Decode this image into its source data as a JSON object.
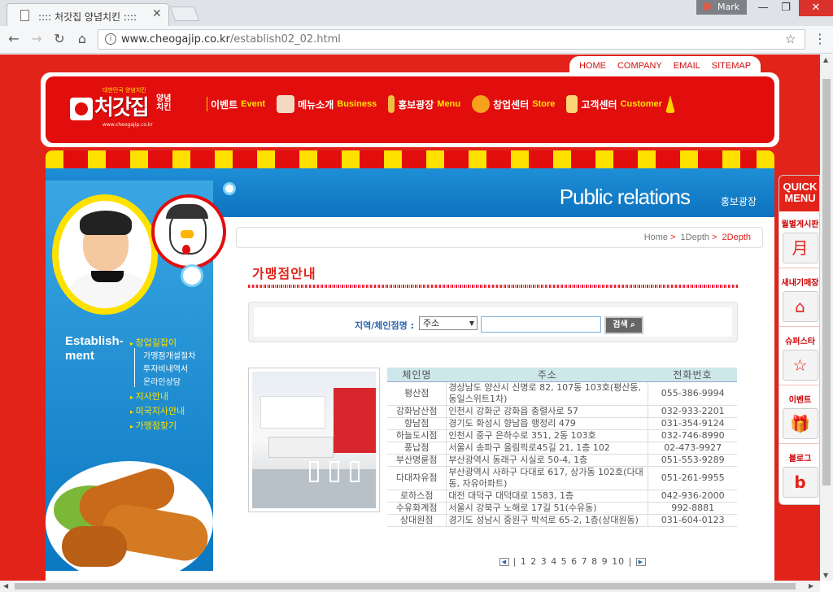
{
  "browser": {
    "tab_title": ":::: 처갓집 양념치킨 ::::",
    "user": "Mark",
    "url_host": "www.cheogajip.co.kr",
    "url_path": "/establish02_02.html"
  },
  "site": {
    "top_links": [
      "HOME",
      "COMPANY",
      "EMAIL",
      "SITEMAP"
    ],
    "logo_text": "처갓집",
    "logo_sub": "양념치킨",
    "nav": [
      {
        "ko": "이벤트",
        "en": "Event"
      },
      {
        "ko": "메뉴소개",
        "en": "Business"
      },
      {
        "ko": "홍보광장",
        "en": "Menu"
      },
      {
        "ko": "창업센터",
        "en": "Store"
      },
      {
        "ko": "고객센터",
        "en": "Customer"
      }
    ],
    "banner_title": "Public relations",
    "banner_sub": "홍보광장",
    "left_title_1": "Establish-",
    "left_title_2": "ment",
    "left_menu": [
      {
        "label": "창업길잡이",
        "sub": false
      },
      {
        "label": "가맹점개설절차",
        "sub": true
      },
      {
        "label": "투자비내역서",
        "sub": true
      },
      {
        "label": "온라인상담",
        "sub": true
      },
      {
        "label": "지사안내",
        "sub": false
      },
      {
        "label": "미국지사안내",
        "sub": false
      },
      {
        "label": "가맹점찾기",
        "sub": false
      }
    ],
    "breadcrumb": {
      "home": "Home",
      "d1": "1Depth",
      "d2": "2Depth"
    },
    "page_title": "가맹점안내",
    "search": {
      "label": "지역/체인점명 :",
      "select_value": "주소",
      "input_value": "",
      "button": "검색"
    },
    "table": {
      "headers": [
        "체인명",
        "주소",
        "전화번호"
      ],
      "rows": [
        [
          "평산점",
          "경상남도 양산시 신명로 82, 107동 103호(평산동, 동일스위트1차)",
          "055-386-9994"
        ],
        [
          "강화남산점",
          "인천시 강화군 강화읍 충렬사로 57",
          "032-933-2201"
        ],
        [
          "향남점",
          "경기도 화성시 향남읍 행정리 479",
          "031-354-9124"
        ],
        [
          "하늘도시점",
          "인천시 중구 은하수로 351, 2동 103호",
          "032-746-8990"
        ],
        [
          "풍납점",
          "서울시 송파구 올림픽로45길 21, 1층 102",
          "02-473-9927"
        ],
        [
          "부산명륜점",
          "부산광역시 동래구 시실로 50-4, 1층",
          "051-553-9289"
        ],
        [
          "다대자유점",
          "부산광역시 사하구 다대로 617, 상가동 102호(다대동, 자유아파트)",
          "051-261-9955"
        ],
        [
          "로하스점",
          "대전 대덕구 대덕대로 1583, 1층",
          "042-936-2000"
        ],
        [
          "수유화계점",
          "서울시 강북구 노해로 17길 51(수유동)",
          "992-8881"
        ],
        [
          "상대원점",
          "경기도 성남시 중원구 박석로 65-2, 1층(상대원동)",
          "031-604-0123"
        ]
      ]
    },
    "pager": "| 1 2 3 4 5 6 7 8 9 10 |",
    "quick": {
      "title_1": "QUICK",
      "title_2": "MENU",
      "items": [
        {
          "label": "월별게시판",
          "icon": "月"
        },
        {
          "label": "새내기매장",
          "icon": "⌂"
        },
        {
          "label": "슈퍼스타",
          "icon": "☆"
        },
        {
          "label": "이벤트",
          "icon": "🎁"
        },
        {
          "label": "블로그",
          "icon": "b"
        }
      ]
    },
    "colors": {
      "brand_red": "#e2231a",
      "yellow": "#ffe100",
      "blue": "#0d72bf"
    }
  }
}
